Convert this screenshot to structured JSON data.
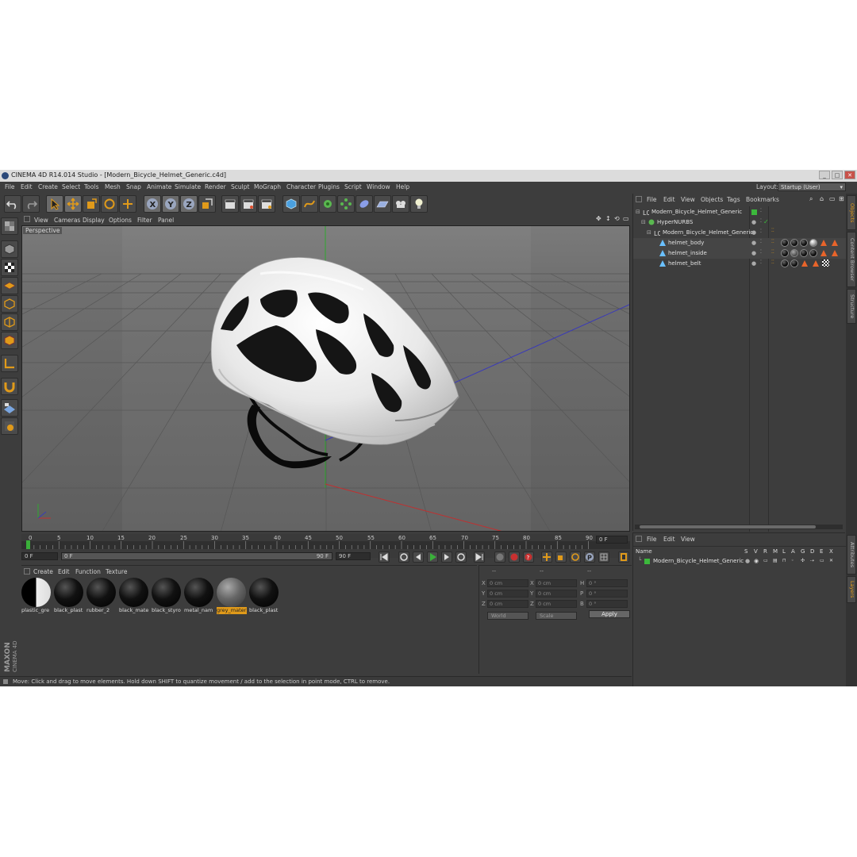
{
  "window": {
    "title": "CINEMA 4D R14.014 Studio - [Modern_Bicycle_Helmet_Generic.c4d]",
    "controls": [
      "_",
      "□",
      "✕"
    ]
  },
  "menubar": {
    "items": [
      "File",
      "Edit",
      "Create",
      "Select",
      "Tools",
      "Mesh",
      "Snap",
      "Animate",
      "Simulate",
      "Render",
      "Sculpt",
      "MoGraph",
      "Character",
      "Plugins",
      "Script",
      "Window",
      "Help"
    ],
    "layout_label": "Layout:",
    "layout_value": "Startup (User)"
  },
  "viewport": {
    "menu": [
      "View",
      "Cameras",
      "Display",
      "Options",
      "Filter",
      "Panel"
    ],
    "label": "Perspective"
  },
  "timeline": {
    "ticks": [
      "0",
      "5",
      "10",
      "15",
      "20",
      "25",
      "30",
      "35",
      "40",
      "45",
      "50",
      "55",
      "60",
      "65",
      "70",
      "75",
      "80",
      "85",
      "90"
    ],
    "end_frame": "0 F",
    "start_field": "0 F",
    "current_field": "0 F",
    "range_end": "90 F",
    "max_field": "90 F"
  },
  "materials": {
    "menu": [
      "Create",
      "Edit",
      "Function",
      "Texture"
    ],
    "items": [
      {
        "name": "plastic_gre",
        "selected": false,
        "style": "split"
      },
      {
        "name": "black_plast",
        "selected": false,
        "style": "black"
      },
      {
        "name": "rubber_2",
        "selected": false,
        "style": "black"
      },
      {
        "name": "black_mate",
        "selected": false,
        "style": "black"
      },
      {
        "name": "black_styro",
        "selected": false,
        "style": "black"
      },
      {
        "name": "metal_nam",
        "selected": false,
        "style": "black"
      },
      {
        "name": "grey_mater",
        "selected": true,
        "style": "grey"
      },
      {
        "name": "black_plast",
        "selected": false,
        "style": "black"
      }
    ]
  },
  "coordinates": {
    "headers": [
      "--",
      "--",
      "--"
    ],
    "rows": [
      {
        "a": "X",
        "av": "0 cm",
        "b": "X",
        "bv": "0 cm",
        "c": "H",
        "cv": "0 °"
      },
      {
        "a": "Y",
        "av": "0 cm",
        "b": "Y",
        "bv": "0 cm",
        "c": "P",
        "cv": "0 °"
      },
      {
        "a": "Z",
        "av": "0 cm",
        "b": "Z",
        "bv": "0 cm",
        "c": "B",
        "cv": "0 °"
      }
    ],
    "mode1": "World",
    "mode2": "Scale",
    "apply": "Apply"
  },
  "objects": {
    "menu": [
      "File",
      "Edit",
      "View",
      "Objects",
      "Tags",
      "Bookmarks"
    ],
    "rows": [
      {
        "name": "Modern_Bicycle_Helmet_Generic",
        "type": "null"
      },
      {
        "name": "HyperNURBS",
        "type": "hypernurbs"
      },
      {
        "name": "Modern_Bicycle_Helmet_Generic",
        "type": "null"
      },
      {
        "name": "helmet_body",
        "type": "poly"
      },
      {
        "name": "helmet_inside",
        "type": "poly"
      },
      {
        "name": "helmet_belt",
        "type": "poly"
      }
    ]
  },
  "layers": {
    "menu": [
      "File",
      "Edit",
      "View"
    ],
    "columns": [
      "Name",
      "S",
      "V",
      "R",
      "M",
      "L",
      "A",
      "G",
      "D",
      "E",
      "X"
    ],
    "row": "Modern_Bicycle_Helmet_Generic",
    "layer_color": "#3cb93c"
  },
  "side_tabs": [
    "Objects",
    "Content Browser",
    "Structure"
  ],
  "side_tabs2": [
    "Attributes",
    "Layers"
  ],
  "status": "Move: Click and drag to move elements. Hold down SHIFT to quantize movement / add to the selection in point mode, CTRL to remove.",
  "branding": {
    "maxon": "MAXON",
    "product": "CINEMA 4D"
  },
  "colors": {
    "accent": "#e09a1a",
    "viewport_bg": "#656565",
    "panel_bg": "#3d3d3d",
    "helmet": "#f2f2f2"
  }
}
